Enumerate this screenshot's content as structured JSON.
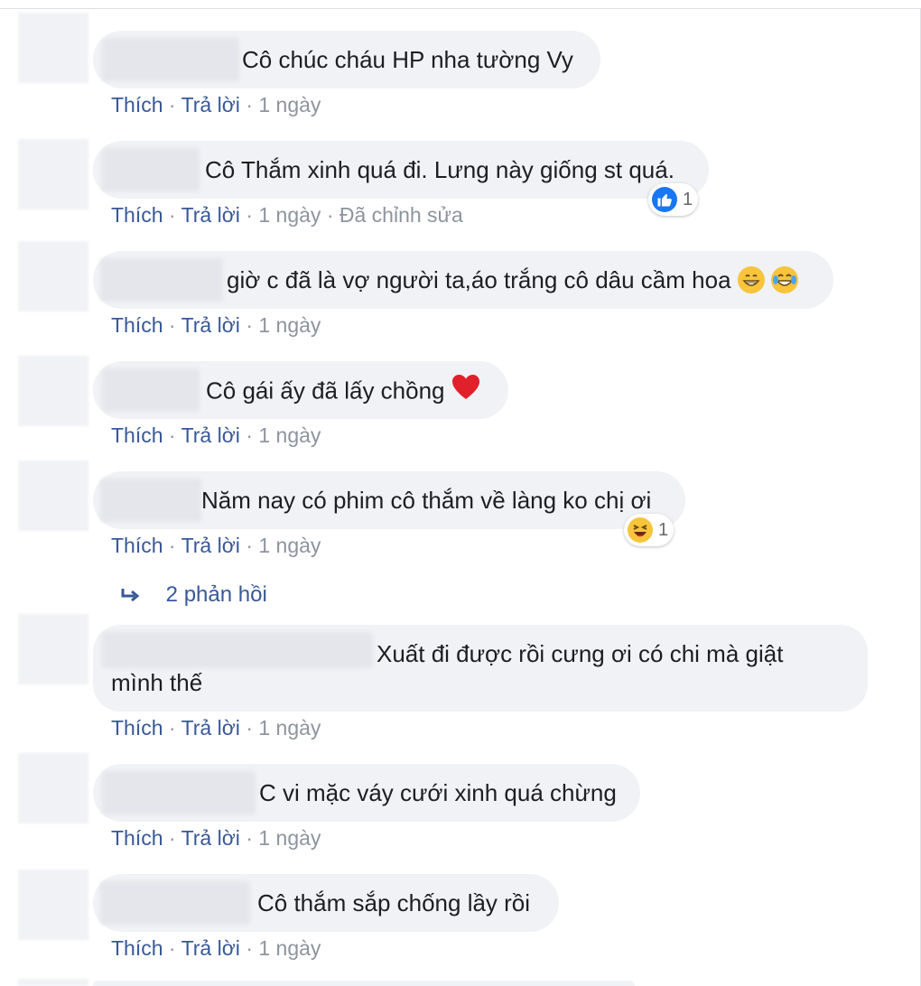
{
  "comments": [
    {
      "text": "Cô chúc cháu HP nha tường Vy",
      "meta": {
        "like": "Thích",
        "reply": "Trả lời",
        "time": "1 ngày"
      }
    },
    {
      "text": "Cô Thắm xinh quá đi. Lưng này giống st quá.",
      "meta": {
        "like": "Thích",
        "reply": "Trả lời",
        "time": "1 ngày",
        "edited": "Đã chỉnh sửa"
      },
      "reaction": {
        "icon": "like-icon",
        "count": "1"
      }
    },
    {
      "text": "giờ c đã là vợ người ta,áo trắng cô dâu cầm hoa",
      "meta": {
        "like": "Thích",
        "reply": "Trả lời",
        "time": "1 ngày"
      }
    },
    {
      "text": "Cô gái ấy đã lấy chồng",
      "meta": {
        "like": "Thích",
        "reply": "Trả lời",
        "time": "1 ngày"
      }
    },
    {
      "text": "Năm nay có phim cô thắm về làng ko chị ơi",
      "meta": {
        "like": "Thích",
        "reply": "Trả lời",
        "time": "1 ngày"
      },
      "reaction": {
        "icon": "haha-icon",
        "count": "1"
      }
    },
    {
      "text_line1": "Xuất đi được rồi cưng ơi có chi mà giật",
      "text_line2": "mình thế",
      "meta": {
        "like": "Thích",
        "reply": "Trả lời",
        "time": "1 ngày"
      }
    },
    {
      "text": "C vi mặc váy cưới xinh quá chừng",
      "meta": {
        "like": "Thích",
        "reply": "Trả lời",
        "time": "1 ngày"
      }
    },
    {
      "text": "Cô thắm sắp chống lầy rồi",
      "meta": {
        "like": "Thích",
        "reply": "Trả lời",
        "time": "1 ngày"
      }
    }
  ],
  "replies_link": "2 phản hồi",
  "separator": "·",
  "colors": {
    "link": "#385898",
    "bubble": "#f0f2f5",
    "text": "#1c1e21",
    "meta": "#8d949e",
    "like": "#1877f2"
  }
}
